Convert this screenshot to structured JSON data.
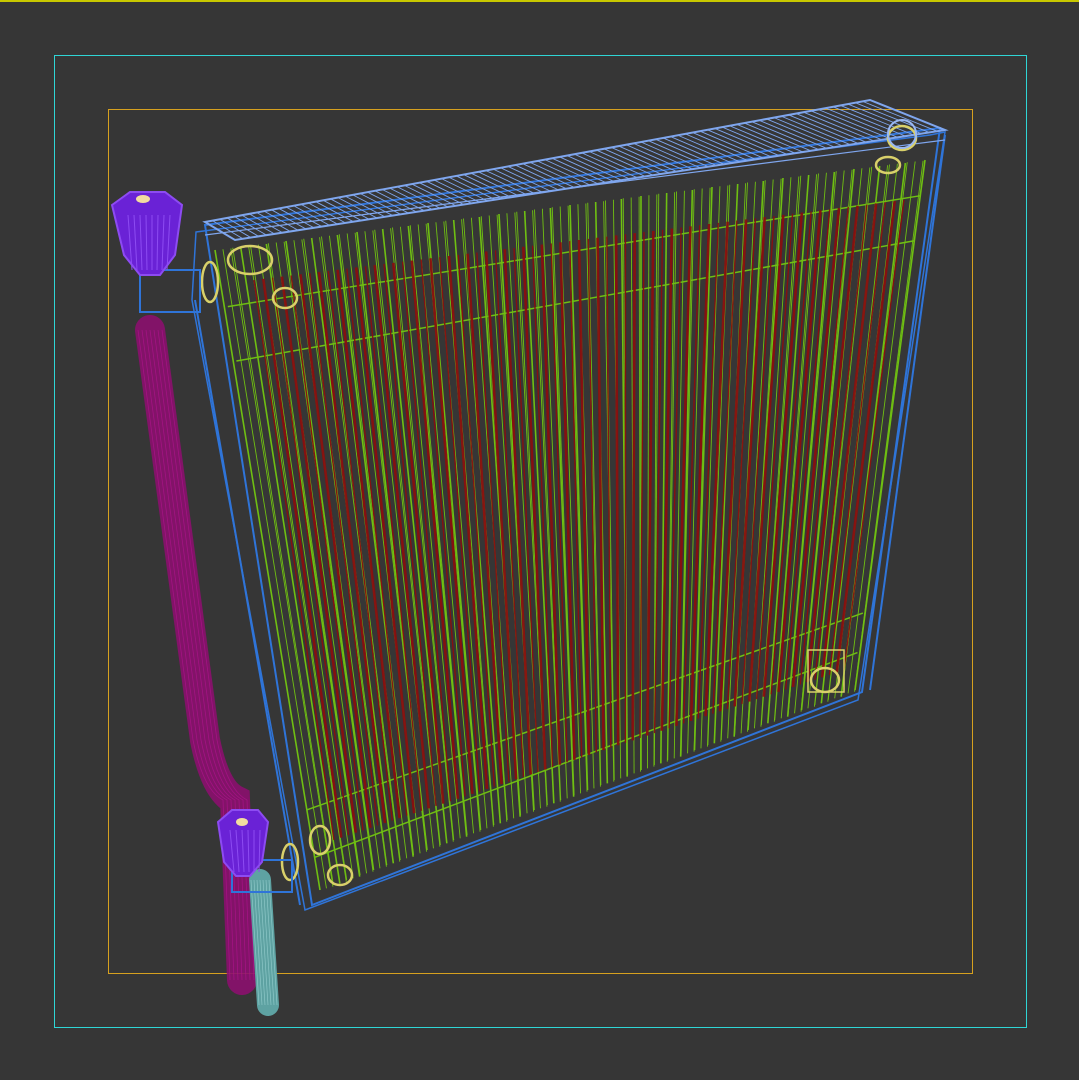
{
  "viewport": {
    "background": "#363636",
    "active_border_color": "#c8c800",
    "safe_frame_color": "#2fd6d6",
    "action_safe_frame_color": "#d7a11f",
    "shading_mode": "wireframe"
  },
  "scene": {
    "object": "panel-radiator",
    "colors": {
      "radiator_outline": "#2f74d8",
      "top_grille": "#7fa6ee",
      "convector_fins": "#6fbf12",
      "panel_core": "#8a0f0f",
      "pipe_magenta": "#8b0f6e",
      "pipe_teal": "#5ea2a2",
      "valve_caps": "#6a22d6",
      "valve_caps_light": "#8d4bf2",
      "fittings": "#d9d06a",
      "connector_outline": "#2f74d8"
    }
  }
}
